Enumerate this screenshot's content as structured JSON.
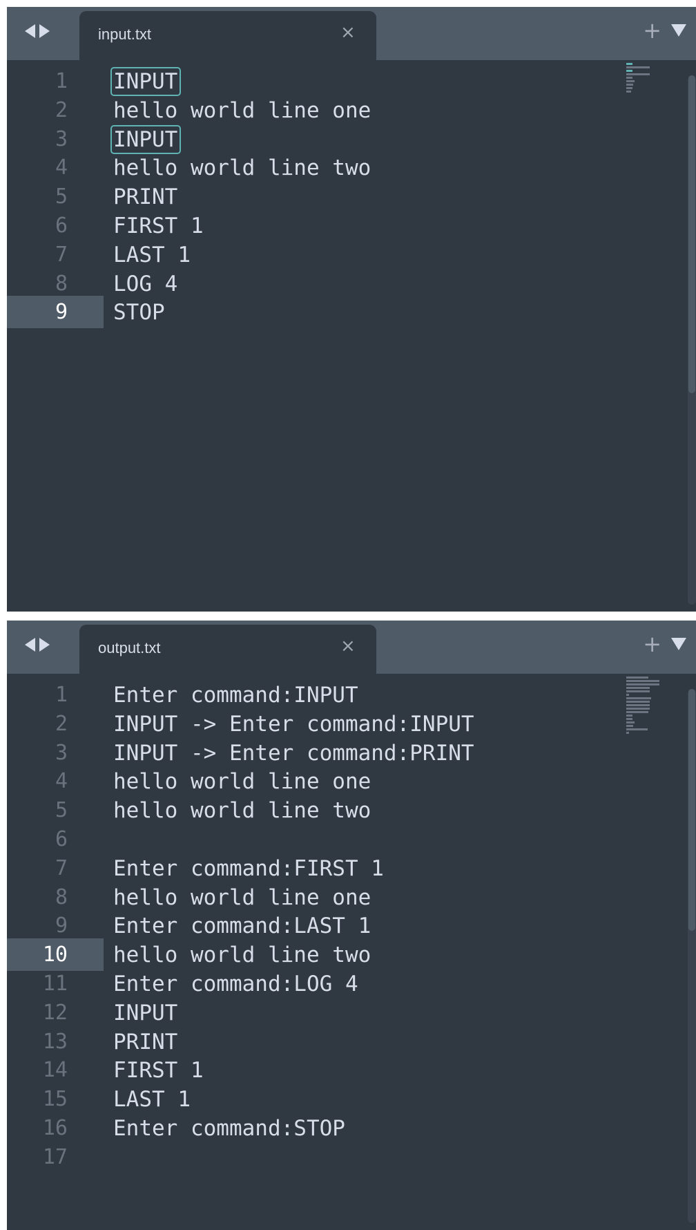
{
  "editors": {
    "top": {
      "tab_label": "input.txt",
      "close_glyph": "×",
      "plus_glyph": "+",
      "current_line": 9,
      "highlighted_lines": [
        1,
        3
      ],
      "lines": [
        {
          "num": "1",
          "text": "INPUT"
        },
        {
          "num": "2",
          "text": "hello world line one"
        },
        {
          "num": "3",
          "text": "INPUT"
        },
        {
          "num": "4",
          "text": "hello world line two"
        },
        {
          "num": "5",
          "text": "PRINT"
        },
        {
          "num": "6",
          "text": "FIRST 1"
        },
        {
          "num": "7",
          "text": "LAST 1"
        },
        {
          "num": "8",
          "text": "LOG 4"
        },
        {
          "num": "9",
          "text": "STOP"
        }
      ]
    },
    "bottom": {
      "tab_label": "output.txt",
      "close_glyph": "×",
      "plus_glyph": "+",
      "current_line": 10,
      "highlighted_lines": [],
      "lines": [
        {
          "num": "1",
          "text": "Enter command:INPUT"
        },
        {
          "num": "2",
          "text": "INPUT -> Enter command:INPUT"
        },
        {
          "num": "3",
          "text": "INPUT -> Enter command:PRINT"
        },
        {
          "num": "4",
          "text": "hello world line one"
        },
        {
          "num": "5",
          "text": "hello world line two"
        },
        {
          "num": "6",
          "text": ""
        },
        {
          "num": "7",
          "text": "Enter command:FIRST 1"
        },
        {
          "num": "8",
          "text": "hello world line one"
        },
        {
          "num": "9",
          "text": "Enter command:LAST 1"
        },
        {
          "num": "10",
          "text": "hello world line two"
        },
        {
          "num": "11",
          "text": "Enter command:LOG 4"
        },
        {
          "num": "12",
          "text": "INPUT"
        },
        {
          "num": "13",
          "text": "PRINT"
        },
        {
          "num": "14",
          "text": "FIRST 1"
        },
        {
          "num": "15",
          "text": "LAST 1"
        },
        {
          "num": "16",
          "text": "Enter command:STOP"
        },
        {
          "num": "17",
          "text": ""
        }
      ]
    }
  },
  "colors": {
    "editor_bg": "#303841",
    "tabbar_bg": "#4f5b66",
    "text": "#d8dee9",
    "line_number": "#69737e",
    "find_highlight": "#5fb3b3"
  },
  "icons": [
    "nav-left-icon",
    "nav-right-icon",
    "close-icon",
    "plus-icon",
    "dropdown-icon"
  ]
}
